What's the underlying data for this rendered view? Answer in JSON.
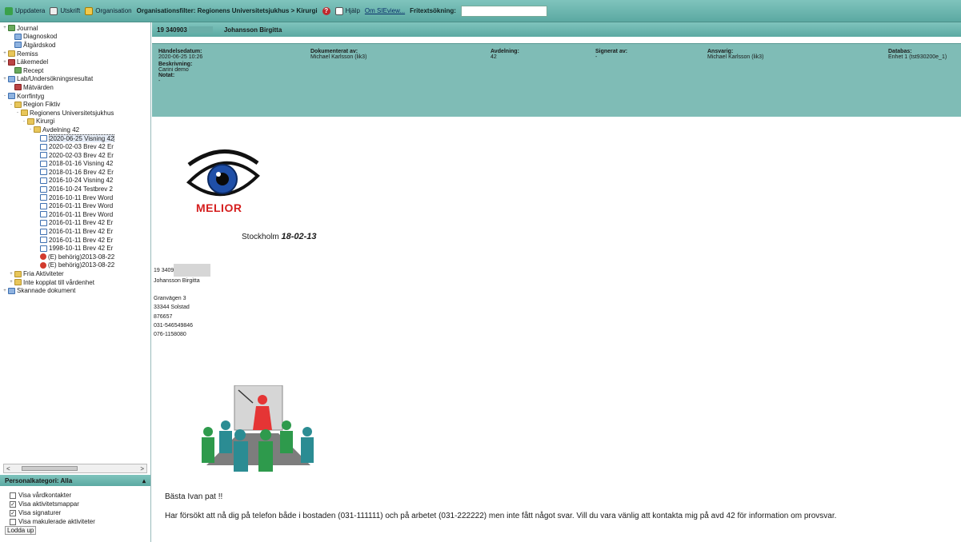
{
  "toolbar": {
    "update_label": "Uppdatera",
    "print_label": "Utskrift",
    "organisation_label": "Organisation",
    "filter_label": "Organisationsfilter: Regionens Universitetsjukhus > Kirurgi",
    "help_label": "Hjälp",
    "about_label": "Om SIEview...",
    "search_label": "Fritextsökning:",
    "search_value": ""
  },
  "tree": {
    "items": [
      {
        "label": "Journal",
        "icon": "journal-icon",
        "exp": "+",
        "indent": 0,
        "kind": "green"
      },
      {
        "label": "Diagnoskod",
        "icon": "diagnosis-icon",
        "exp": "",
        "indent": 1,
        "kind": "blue-doc"
      },
      {
        "label": "Åtgärdskod",
        "icon": "procedure-icon",
        "exp": "",
        "indent": 1,
        "kind": "blue-doc"
      },
      {
        "label": "Remiss",
        "icon": "folder-icon",
        "exp": "+",
        "indent": 0,
        "kind": "folder"
      },
      {
        "label": "Läkemedel",
        "icon": "medicine-icon",
        "exp": "+",
        "indent": 0,
        "kind": "pill"
      },
      {
        "label": "Recept",
        "icon": "prescription-icon",
        "exp": "",
        "indent": 1,
        "kind": "green"
      },
      {
        "label": "Lab/Undersökningsresultat",
        "icon": "lab-icon",
        "exp": "+",
        "indent": 0,
        "kind": "blue-doc"
      },
      {
        "label": "Mätvärden",
        "icon": "measurement-icon",
        "exp": "",
        "indent": 1,
        "kind": "pill"
      },
      {
        "label": "Korrfintyg",
        "icon": "certificate-icon",
        "exp": "-",
        "indent": 0,
        "kind": "blue-doc"
      },
      {
        "label": "Region Fiktiv",
        "icon": "folder-icon",
        "exp": "-",
        "indent": 1,
        "kind": "folder"
      },
      {
        "label": "Regionens Universitetsjukhus",
        "icon": "folder-icon",
        "exp": "-",
        "indent": 2,
        "kind": "folder"
      },
      {
        "label": "Kirurgi",
        "icon": "folder-icon",
        "exp": "-",
        "indent": 3,
        "kind": "folder"
      },
      {
        "label": "Avdelning 42",
        "icon": "folder-icon",
        "exp": "-",
        "indent": 4,
        "kind": "folder"
      },
      {
        "label": "2020-06-25 Visning 42",
        "icon": "document-icon",
        "exp": "",
        "indent": 5,
        "kind": "doc",
        "selected": true
      },
      {
        "label": "2020-02-03 Brev 42 Er",
        "icon": "document-icon",
        "exp": "",
        "indent": 5,
        "kind": "doc"
      },
      {
        "label": "2020-02-03 Brev 42 Er",
        "icon": "document-icon",
        "exp": "",
        "indent": 5,
        "kind": "doc"
      },
      {
        "label": "2018-01-16 Visning 42",
        "icon": "document-icon",
        "exp": "",
        "indent": 5,
        "kind": "doc"
      },
      {
        "label": "2018-01-16 Brev 42 Er",
        "icon": "document-icon",
        "exp": "",
        "indent": 5,
        "kind": "doc"
      },
      {
        "label": "2016-10-24 Visning 42",
        "icon": "document-icon",
        "exp": "",
        "indent": 5,
        "kind": "doc"
      },
      {
        "label": "2016-10-24 Testbrev 2",
        "icon": "document-icon",
        "exp": "",
        "indent": 5,
        "kind": "doc"
      },
      {
        "label": "2016-10-11 Brev Word",
        "icon": "document-icon",
        "exp": "",
        "indent": 5,
        "kind": "doc"
      },
      {
        "label": "2016-01-11 Brev Word",
        "icon": "document-icon",
        "exp": "",
        "indent": 5,
        "kind": "doc"
      },
      {
        "label": "2016-01-11 Brev Word",
        "icon": "document-icon",
        "exp": "",
        "indent": 5,
        "kind": "doc"
      },
      {
        "label": "2016-01-11 Brev 42 Er",
        "icon": "document-icon",
        "exp": "",
        "indent": 5,
        "kind": "doc"
      },
      {
        "label": "2016-01-11 Brev 42 Er",
        "icon": "document-icon",
        "exp": "",
        "indent": 5,
        "kind": "doc"
      },
      {
        "label": "2016-01-11 Brev 42 Er",
        "icon": "document-icon",
        "exp": "",
        "indent": 5,
        "kind": "doc"
      },
      {
        "label": "1998-10-11 Brev 42 Er",
        "icon": "document-icon",
        "exp": "",
        "indent": 5,
        "kind": "doc"
      },
      {
        "label": "(E) behörig)2013-08-22",
        "icon": "restricted-icon",
        "exp": "",
        "indent": 5,
        "kind": "red-dot"
      },
      {
        "label": "(E) behörig)2013-08-22",
        "icon": "restricted-icon",
        "exp": "",
        "indent": 5,
        "kind": "red-dot"
      },
      {
        "label": "Fria Aktiviteter",
        "icon": "folder-icon",
        "exp": "+",
        "indent": 1,
        "kind": "folder"
      },
      {
        "label": "Inte kopplat till vårdenhet",
        "icon": "folder-icon",
        "exp": "+",
        "indent": 1,
        "kind": "folder"
      },
      {
        "label": "Skannade dokument",
        "icon": "scan-icon",
        "exp": "+",
        "indent": 0,
        "kind": "blue-doc"
      }
    ]
  },
  "personal": {
    "header": "Personalkategori: Alla",
    "options": [
      {
        "label": "Visa vårdkontakter",
        "checked": false
      },
      {
        "label": "Visa aktivitetsmappar",
        "checked": true
      },
      {
        "label": "Visa signaturer",
        "checked": true
      },
      {
        "label": "Visa makulerade aktiviteter",
        "checked": false
      }
    ],
    "footer": "Lodda up"
  },
  "patient": {
    "id": "19 340903",
    "name": "Johansson Birgitta"
  },
  "meta": {
    "event_label": "Händelsedatum:",
    "event_value": "2020-06-25 10:26",
    "documented_label": "Dokumenterat av:",
    "documented_value": "Michael Karlsson (lik3)",
    "department_label": "Avdelning:",
    "department_value": "42",
    "signed_label": "Signerat av:",
    "signed_value": "-",
    "responsible_label": "Ansvarig:",
    "responsible_value": "Michael Karlsson (lik3)",
    "database_label": "Databas:",
    "database_value": "Enhet 1 (tst930200e_1)",
    "description_label": "Beskrivning:",
    "description_value": "Carini demo",
    "note_label": "Notat:",
    "note_value": "-"
  },
  "letter": {
    "logo_text": "MELIOR",
    "city": "Stockholm",
    "date": "18-02-13",
    "address": {
      "pnr": "19 3409",
      "name": "Johansson Birgitta",
      "street": "Granvägen 3",
      "postal": "33344 Solstad",
      "phone1": "876657",
      "phone2": "031-546549846",
      "phone3": "076-1158080"
    },
    "greeting": "Bästa Ivan pat !!",
    "message": "Har försökt att nå dig på telefon både i bostaden (031-111111)  och på arbetet (031-222222)  men inte fått något svar.  Vill du vara vänlig att kontakta mig på avd 42 för information om provsvar."
  }
}
